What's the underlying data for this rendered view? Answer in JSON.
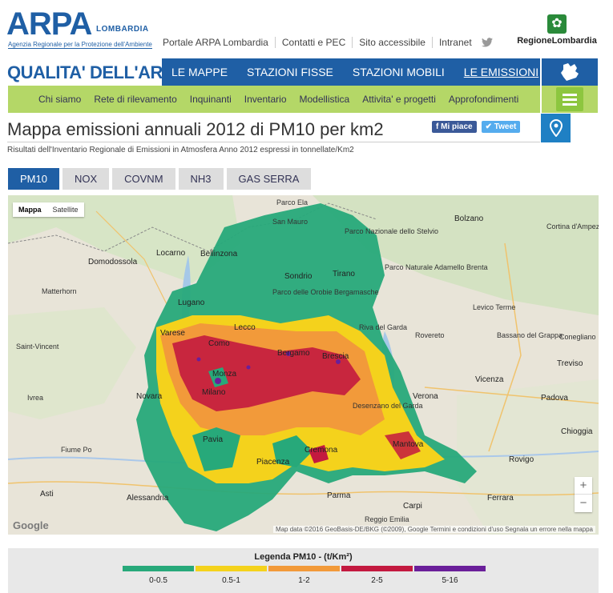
{
  "header": {
    "logo_main": "ARPA",
    "logo_region": "LOMBARDIA",
    "logo_tagline": "Agenzia Regionale per la Protezione dell'Ambiente",
    "top_links": [
      "Portale ARPA Lombardia",
      "Contatti e PEC",
      "Sito accessibile",
      "Intranet"
    ],
    "regione_name": "RegioneLombardia"
  },
  "section_title": "QUALITA' DELL'ARIA",
  "main_nav": [
    "LE MAPPE",
    "STAZIONI FISSE",
    "STAZIONI MOBILI",
    "LE EMISSIONI"
  ],
  "main_nav_active": "LE EMISSIONI",
  "sub_nav": [
    "Chi siamo",
    "Rete di rilevamento",
    "Inquinanti",
    "Inventario",
    "Modellistica",
    "Attivita' e progetti",
    "Approfondimenti"
  ],
  "page": {
    "title": "Mappa emissioni annuali 2012 di PM10 per km2",
    "subtitle": "Risultati dell'Inventario Regionale di Emissioni in Atmosfera Anno 2012 espressi in tonnellate/Km2",
    "like_label": "Mi piace",
    "tweet_label": "Tweet"
  },
  "tabs": [
    "PM10",
    "NOX",
    "COVNM",
    "NH3",
    "GAS SERRA"
  ],
  "active_tab": "PM10",
  "map": {
    "type_buttons": [
      "Mappa",
      "Satellite"
    ],
    "selected_type": "Mappa",
    "zoom_in": "+",
    "zoom_out": "−",
    "google_label": "Google",
    "attribution": "Map data ©2016 GeoBasis-DE/BKG (©2009), Google   Termini e condizioni d'uso   Segnala un errore nella mappa",
    "places": [
      "Bolzano",
      "Cortina d'Ampezzo",
      "Parco Ela",
      "San Mauro",
      "Parco Nazionale dello Stelvio",
      "Parco Naturale Adamello Brenta",
      "Domodossola",
      "Locarno",
      "Bellinzona",
      "Sondrio",
      "Tirano",
      "Parco delle Orobie Bergamasche",
      "Lugano",
      "Lecco",
      "Riva del Garda",
      "Levico Terme",
      "Bassano del Grappa",
      "Conegliano",
      "Varese",
      "Como",
      "Bergamo",
      "Rovereto",
      "Monza",
      "Brescia",
      "Vicenza",
      "Treviso",
      "Novara",
      "Milano",
      "Verona",
      "Padova",
      "Pavia",
      "Desenzano del Garda",
      "Mantova",
      "Cremona",
      "Piacenza",
      "Rovigo",
      "Chioggia",
      "Alessandria",
      "Asti",
      "Parma",
      "Reggio Emilia",
      "Ferrara",
      "Matterhorn",
      "Saint-Vincent",
      "Ivrea",
      "Fiume Po",
      "Carpi"
    ]
  },
  "legend": {
    "title": "Legenda PM10 - (t/Km²)",
    "classes": [
      {
        "label": "0-0.5",
        "color": "#27a97a"
      },
      {
        "label": "0.5-1",
        "color": "#f4d21c"
      },
      {
        "label": "1-2",
        "color": "#f29a3a"
      },
      {
        "label": "2-5",
        "color": "#c3193f"
      },
      {
        "label": "5-16",
        "color": "#6a1f9a"
      }
    ]
  }
}
